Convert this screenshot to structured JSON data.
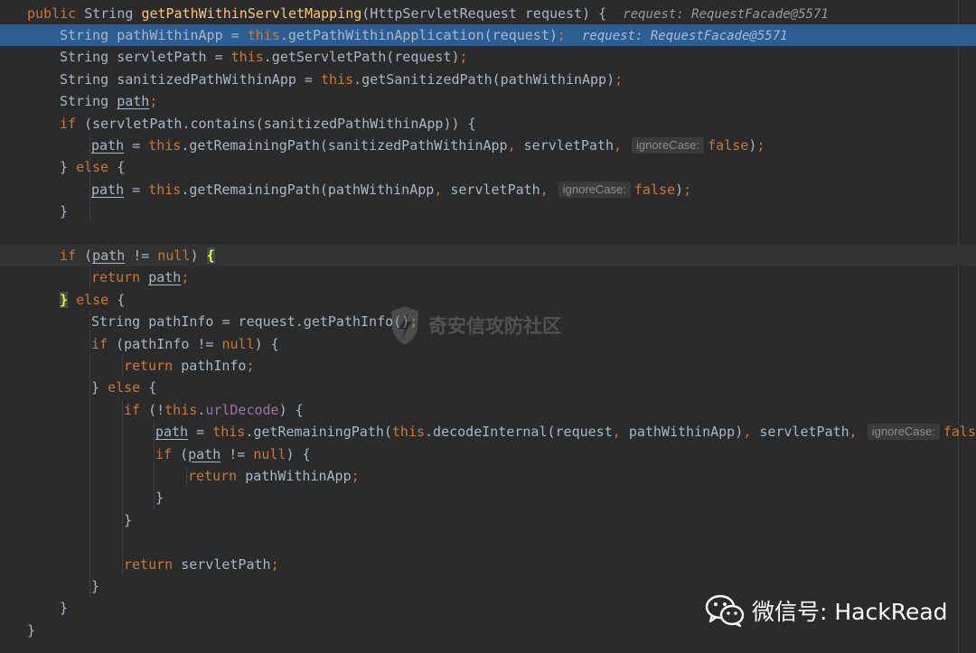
{
  "editor": {
    "lines": [
      {
        "parts": [
          [
            "kw",
            "public "
          ],
          [
            "",
            "String "
          ],
          [
            "fn",
            "getPathWithinServletMapping"
          ],
          [
            "",
            "(HttpServletRequest request) {  "
          ],
          [
            "hint",
            "request: RequestFacade@5571"
          ]
        ]
      },
      {
        "parts": [
          [
            "",
            "String pathWithinApp = "
          ],
          [
            "kw",
            "this"
          ],
          [
            "",
            ".getPathWithinApplication(request)"
          ],
          [
            "kw",
            ";"
          ],
          [
            "",
            "  "
          ],
          [
            "hint",
            "request: RequestFacade@5571"
          ]
        ]
      },
      {
        "parts": [
          [
            "",
            "String servletPath = "
          ],
          [
            "kw",
            "this"
          ],
          [
            "",
            ".getServletPath(request)"
          ],
          [
            "kw",
            ";"
          ]
        ]
      },
      {
        "parts": [
          [
            "",
            "String sanitizedPathWithinApp = "
          ],
          [
            "kw",
            "this"
          ],
          [
            "",
            ".getSanitizedPath(pathWithinApp)"
          ],
          [
            "kw",
            ";"
          ]
        ]
      },
      {
        "parts": [
          [
            "",
            "String "
          ],
          [
            "u",
            "path"
          ],
          [
            "kw",
            ";"
          ]
        ]
      },
      {
        "parts": [
          [
            "kw",
            "if "
          ],
          [
            "",
            "(servletPath.contains(sanitizedPathWithinApp)) {"
          ]
        ]
      },
      {
        "parts": [
          [
            "u",
            "path"
          ],
          [
            "",
            " = "
          ],
          [
            "kw",
            "this"
          ],
          [
            "",
            ".getRemainingPath(sanitizedPathWithinApp"
          ],
          [
            "kw",
            ", "
          ],
          [
            "",
            "servletPath"
          ],
          [
            "kw",
            ", "
          ],
          [
            "ph",
            "ignoreCase:"
          ],
          [
            "kw",
            "false"
          ],
          [
            "",
            ")"
          ],
          [
            "kw",
            ";"
          ]
        ]
      },
      {
        "parts": [
          [
            "",
            "} "
          ],
          [
            "kw",
            "else "
          ],
          [
            "",
            "{"
          ]
        ]
      },
      {
        "parts": [
          [
            "u",
            "path"
          ],
          [
            "",
            " = "
          ],
          [
            "kw",
            "this"
          ],
          [
            "",
            ".getRemainingPath(pathWithinApp"
          ],
          [
            "kw",
            ", "
          ],
          [
            "",
            "servletPath"
          ],
          [
            "kw",
            ", "
          ],
          [
            "ph",
            "ignoreCase:"
          ],
          [
            "kw",
            "false"
          ],
          [
            "",
            ")"
          ],
          [
            "kw",
            ";"
          ]
        ]
      },
      {
        "parts": [
          [
            "",
            "}"
          ]
        ]
      },
      {
        "parts": []
      },
      {
        "parts": [
          [
            "kw",
            "if "
          ],
          [
            "",
            "("
          ],
          [
            "u",
            "path"
          ],
          [
            "",
            " != "
          ],
          [
            "kw",
            "null"
          ],
          [
            "",
            ") "
          ],
          [
            "br",
            "{"
          ]
        ]
      },
      {
        "parts": [
          [
            "kw",
            "return "
          ],
          [
            "u",
            "path"
          ],
          [
            "kw",
            ";"
          ]
        ]
      },
      {
        "parts": [
          [
            "br",
            "}"
          ],
          [
            "",
            " "
          ],
          [
            "kw",
            "else "
          ],
          [
            "",
            "{"
          ]
        ]
      },
      {
        "parts": [
          [
            "",
            "String pathInfo = request.getPathInfo()"
          ],
          [
            "kw",
            ";"
          ]
        ]
      },
      {
        "parts": [
          [
            "kw",
            "if "
          ],
          [
            "",
            "(pathInfo != "
          ],
          [
            "kw",
            "null"
          ],
          [
            "",
            ") {"
          ]
        ]
      },
      {
        "parts": [
          [
            "kw",
            "return "
          ],
          [
            "",
            "pathInfo"
          ],
          [
            "kw",
            ";"
          ]
        ]
      },
      {
        "parts": [
          [
            "",
            "} "
          ],
          [
            "kw",
            "else "
          ],
          [
            "",
            "{"
          ]
        ]
      },
      {
        "parts": [
          [
            "kw",
            "if "
          ],
          [
            "",
            "(!"
          ],
          [
            "kw",
            "this"
          ],
          [
            "",
            "."
          ],
          [
            "fld",
            "urlDecode"
          ],
          [
            "",
            ") {"
          ]
        ]
      },
      {
        "parts": [
          [
            "u",
            "path"
          ],
          [
            "",
            " = "
          ],
          [
            "kw",
            "this"
          ],
          [
            "",
            ".getRemainingPath("
          ],
          [
            "kw",
            "this"
          ],
          [
            "",
            ".decodeInternal(request"
          ],
          [
            "kw",
            ", "
          ],
          [
            "",
            "pathWithinApp)"
          ],
          [
            "kw",
            ", "
          ],
          [
            "",
            "servletPath"
          ],
          [
            "kw",
            ", "
          ],
          [
            "ph",
            "ignoreCase:"
          ],
          [
            "kw",
            "false"
          ]
        ]
      },
      {
        "parts": [
          [
            "kw",
            "if "
          ],
          [
            "",
            "("
          ],
          [
            "u",
            "path"
          ],
          [
            "",
            " != "
          ],
          [
            "kw",
            "null"
          ],
          [
            "",
            ") {"
          ]
        ]
      },
      {
        "parts": [
          [
            "kw",
            "return "
          ],
          [
            "",
            "pathWithinApp"
          ],
          [
            "kw",
            ";"
          ]
        ]
      },
      {
        "parts": [
          [
            "",
            "}"
          ]
        ]
      },
      {
        "parts": [
          [
            "",
            "}"
          ]
        ]
      },
      {
        "parts": []
      },
      {
        "parts": [
          [
            "kw",
            "return "
          ],
          [
            "",
            "servletPath"
          ],
          [
            "kw",
            ";"
          ]
        ]
      },
      {
        "parts": [
          [
            "",
            "}"
          ]
        ]
      },
      {
        "parts": [
          [
            "",
            "}"
          ]
        ]
      },
      {
        "parts": [
          [
            "",
            "}"
          ]
        ]
      }
    ]
  },
  "watermark": {
    "text": "奇安信攻防社区"
  },
  "footer": {
    "text": "微信号: HackRead"
  },
  "colors": {
    "background": "#2b2b2b",
    "keyword": "#cc7832",
    "method": "#ffc66d",
    "field": "#9876aa",
    "plain": "#a9b7c6",
    "selection": "#2d5e93"
  }
}
